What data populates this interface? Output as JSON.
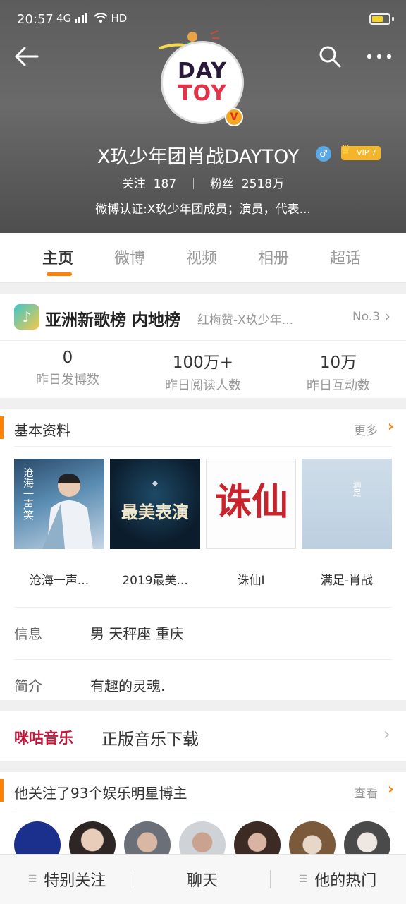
{
  "status_bar": {
    "time": "20:57",
    "signal_text": "4G",
    "network_text": "HD",
    "battery_level": 0.7
  },
  "header": {
    "avatar_text_line1": "DAY",
    "avatar_text_line2": "TOY",
    "verified_mark": "V",
    "user_name": "X玖少年团肖战DAYTOY",
    "gender_symbol": "♂",
    "vip_label": "VIP 7",
    "following_label": "关注",
    "following_count": "187",
    "followers_label": "粉丝",
    "followers_count": "2518万",
    "verification": "微博认证:X玖少年团成员；演员，代表..."
  },
  "tabs": [
    "主页",
    "微博",
    "视频",
    "相册",
    "超话"
  ],
  "chart": {
    "title": "亚洲新歌榜 内地榜",
    "song": "红梅赞-X玖少年...",
    "rank": "No.3",
    "metrics": [
      {
        "value": "0",
        "label": "昨日发博数"
      },
      {
        "value": "100万+",
        "label": "昨日阅读人数"
      },
      {
        "value": "10万",
        "label": "昨日互动数"
      }
    ]
  },
  "profile": {
    "section_title": "基本资料",
    "more_label": "更多",
    "works": [
      {
        "label": "沧海一声...",
        "thumb_text": "沧海一声笑"
      },
      {
        "label": "2019最美...",
        "thumb_text": "最美表演"
      },
      {
        "label": "诛仙I",
        "thumb_text": "诛仙"
      },
      {
        "label": "满足-肖战",
        "thumb_text": "满足"
      }
    ],
    "info_label": "信息",
    "info_value": "男 天秤座 重庆",
    "bio_label": "简介",
    "bio_value": "有趣的灵魂."
  },
  "music": {
    "logo_text": "咪咕音乐",
    "title": "正版音乐下载"
  },
  "following": {
    "title": "他关注了93个娱乐明星博主",
    "view_label": "查看"
  },
  "bottom_bar": {
    "special_follow": "特别关注",
    "chat": "聊天",
    "hot": "他的热门"
  },
  "colors": {
    "accent": "#ff8200",
    "header_bg": "#5c5c5c"
  }
}
